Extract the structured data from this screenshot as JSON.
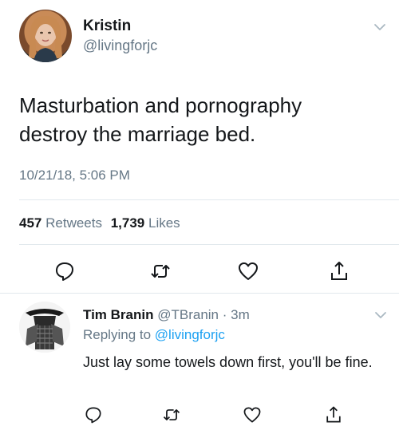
{
  "tweet": {
    "display_name": "Kristin",
    "handle": "@livingforjc",
    "text": "Masturbation and pornography destroy the marriage bed.",
    "timestamp": "10/21/18, 5:06 PM",
    "retweets_count": "457",
    "retweets_label": "Retweets",
    "likes_count": "1,739",
    "likes_label": "Likes"
  },
  "reply": {
    "display_name": "Tim Branin",
    "handle": "@TBranin",
    "separator": "·",
    "time_ago": "3m",
    "replying_to_label": "Replying to",
    "replying_to_handle": "@livingforjc",
    "text": "Just lay some towels down first, you'll be fine."
  },
  "icons": {
    "reply": "reply-icon",
    "retweet": "retweet-icon",
    "like": "heart-icon",
    "share": "share-icon",
    "caret": "chevron-down-icon"
  },
  "colors": {
    "text": "#14171a",
    "secondary": "#657786",
    "link": "#1da1f2",
    "divider": "#e1e8ed"
  }
}
